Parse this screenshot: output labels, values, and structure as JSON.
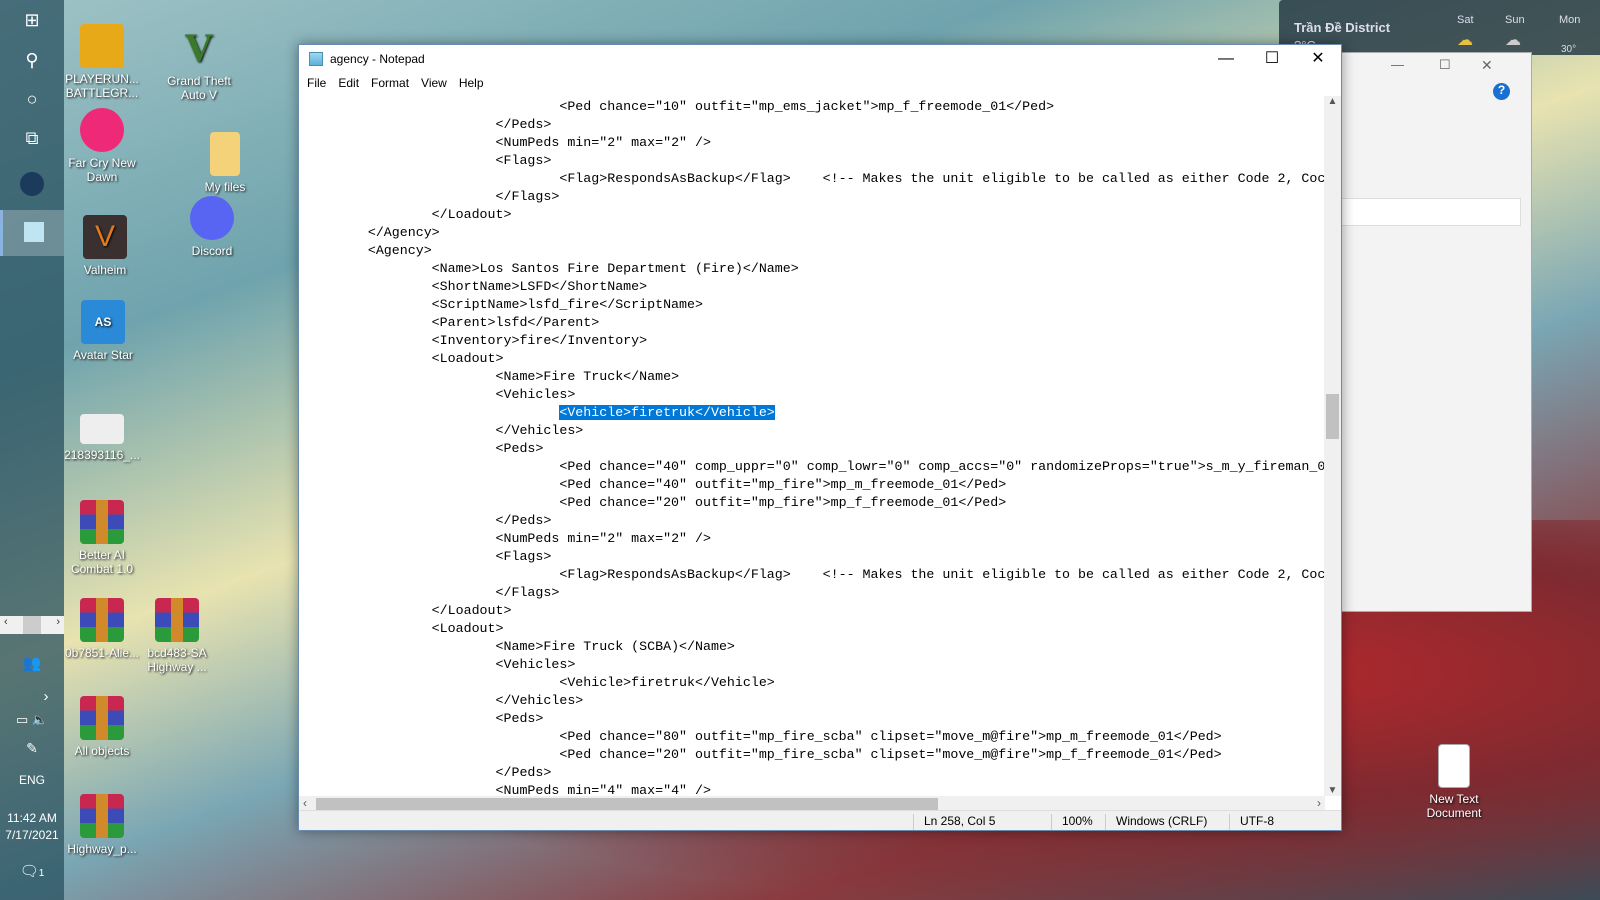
{
  "taskbar": {
    "language": "ENG",
    "time": "11:42 AM",
    "date": "7/17/2021",
    "notification_count": "1"
  },
  "desktop_icons": [
    "PLAYERUN... BATTLEGR...",
    "Grand Theft Auto V",
    "Far Cry New Dawn",
    "My files",
    "Discord",
    "Valheim",
    "Avatar Star",
    "218393116_...",
    "Better AI Combat 1.0",
    "0b7851-Alie...",
    "bcd483-SA Highway ...",
    "All objects",
    "Highway_p...",
    "New Text Document"
  ],
  "weather": {
    "location": "Trần Đề District",
    "temp": "?°C",
    "days": [
      "Sat",
      "Sun",
      "Mon"
    ],
    "mon_temp": "30°"
  },
  "notepad": {
    "title": "agency - Notepad",
    "menu": [
      "File",
      "Edit",
      "Format",
      "View",
      "Help"
    ],
    "lines": [
      "\t\t\t\t<Ped chance=\"10\" outfit=\"mp_ems_jacket\">mp_f_freemode_01</Ped>",
      "\t\t\t</Peds>",
      "\t\t\t<NumPeds min=\"2\" max=\"2\" />",
      "\t\t\t<Flags>",
      "\t\t\t\t<Flag>RespondsAsBackup</Flag>    <!-- Makes the unit eligible to be called as either Code 2, Coc",
      "\t\t\t</Flags>",
      "\t\t</Loadout>",
      "\t</Agency>",
      "\t<Agency>",
      "\t\t<Name>Los Santos Fire Department (Fire)</Name>",
      "\t\t<ShortName>LSFD</ShortName>",
      "\t\t<ScriptName>lsfd_fire</ScriptName>",
      "\t\t<Parent>lsfd</Parent>",
      "\t\t<Inventory>fire</Inventory>",
      "\t\t<Loadout>",
      "\t\t\t<Name>Fire Truck</Name>",
      "\t\t\t<Vehicles>",
      "SELECTED",
      "\t\t\t</Vehicles>",
      "\t\t\t<Peds>",
      "\t\t\t\t<Ped chance=\"40\" comp_uppr=\"0\" comp_lowr=\"0\" comp_accs=\"0\" randomizeProps=\"true\">s_m_y_fireman_0",
      "\t\t\t\t<Ped chance=\"40\" outfit=\"mp_fire\">mp_m_freemode_01</Ped>",
      "\t\t\t\t<Ped chance=\"20\" outfit=\"mp_fire\">mp_f_freemode_01</Ped>",
      "\t\t\t</Peds>",
      "\t\t\t<NumPeds min=\"2\" max=\"2\" />",
      "\t\t\t<Flags>",
      "\t\t\t\t<Flag>RespondsAsBackup</Flag>    <!-- Makes the unit eligible to be called as either Code 2, Coc",
      "\t\t\t</Flags>",
      "\t\t</Loadout>",
      "\t\t<Loadout>",
      "\t\t\t<Name>Fire Truck (SCBA)</Name>",
      "\t\t\t<Vehicles>",
      "\t\t\t\t<Vehicle>firetruk</Vehicle>",
      "\t\t\t</Vehicles>",
      "\t\t\t<Peds>",
      "\t\t\t\t<Ped chance=\"80\" outfit=\"mp_fire_scba\" clipset=\"move_m@fire\">mp_m_freemode_01</Ped>",
      "\t\t\t\t<Ped chance=\"20\" outfit=\"mp_fire_scba\" clipset=\"move_m@fire\">mp_f_freemode_01</Ped>",
      "\t\t\t</Peds>",
      "\t\t\t<NumPeds min=\"4\" max=\"4\" />"
    ],
    "selected_indent": "\t\t\t\t",
    "selected_text": "<Vehicle>firetruk</Vehicle>",
    "status": {
      "position": "Ln 258, Col 5",
      "zoom": "100%",
      "line_ending": "Windows (CRLF)",
      "encoding": "UTF-8"
    }
  }
}
